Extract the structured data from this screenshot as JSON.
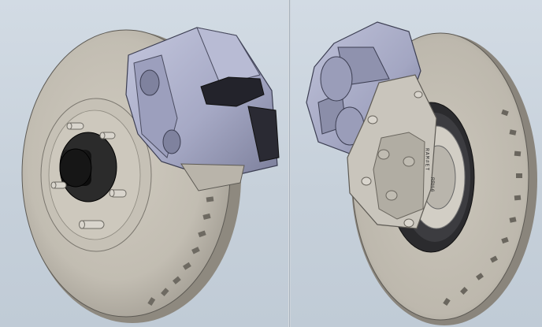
{
  "viewports": {
    "left": {
      "view": "front-isometric",
      "part": "brake-rotor-hub-caliper-assembly"
    },
    "right": {
      "view": "rear-isometric",
      "part": "brake-rotor-caliper-bracket-assembly"
    }
  },
  "bracket_marking": {
    "vertical_text": "RAM#ET",
    "stamp": "RRH-6"
  },
  "colors": {
    "rotor": "#c4bfb4",
    "rotor_dark": "#8a857c",
    "caliper": "#a9acc7",
    "caliper_dark": "#6f7290",
    "hub": "#1b1b1b",
    "stud": "#d8d4cc",
    "bracket": "#c8c4bb",
    "background": "#c9d4de"
  }
}
